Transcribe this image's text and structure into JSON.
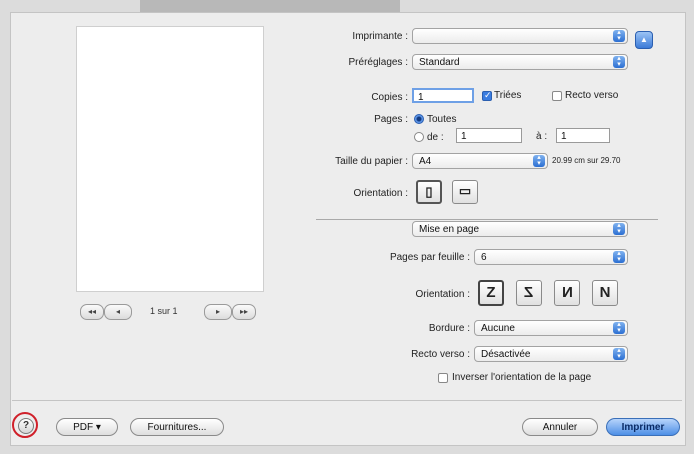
{
  "printer": {
    "label": "Imprimante :",
    "value": ""
  },
  "presets": {
    "label": "Préréglages :",
    "value": "Standard"
  },
  "copies": {
    "label": "Copies :",
    "value": "1",
    "collated_label": "Triées",
    "duplex_label": "Recto verso"
  },
  "pages": {
    "label": "Pages :",
    "all_label": "Toutes",
    "from_label": "de :",
    "from_value": "1",
    "to_label": "à :",
    "to_value": "1"
  },
  "paper": {
    "label": "Taille du papier :",
    "value": "A4",
    "dimensions": "20.99 cm sur 29.70"
  },
  "orientation": {
    "label": "Orientation :"
  },
  "section": {
    "value": "Mise en page"
  },
  "layout": {
    "pages_per_sheet_label": "Pages par feuille :",
    "pages_per_sheet_value": "6",
    "direction_label": "Orientation :",
    "direction_glyphs": [
      "Z",
      "Z",
      "N",
      "N"
    ],
    "border_label": "Bordure :",
    "border_value": "Aucune",
    "duplex_label": "Recto verso :",
    "duplex_value": "Désactivée",
    "reverse_label": "Inverser l'orientation de la page"
  },
  "preview": {
    "page_info": "1 sur 1",
    "nav_first": "◂◂",
    "nav_prev": "◂",
    "nav_next": "▸",
    "nav_last": "▸▸"
  },
  "footer": {
    "help": "?",
    "pdf_label": "PDF ▾",
    "supplies_label": "Fournitures...",
    "cancel_label": "Annuler",
    "print_label": "Imprimer"
  },
  "colors": {
    "accent": "#3c7bd8",
    "help_ring": "#d0202a"
  }
}
